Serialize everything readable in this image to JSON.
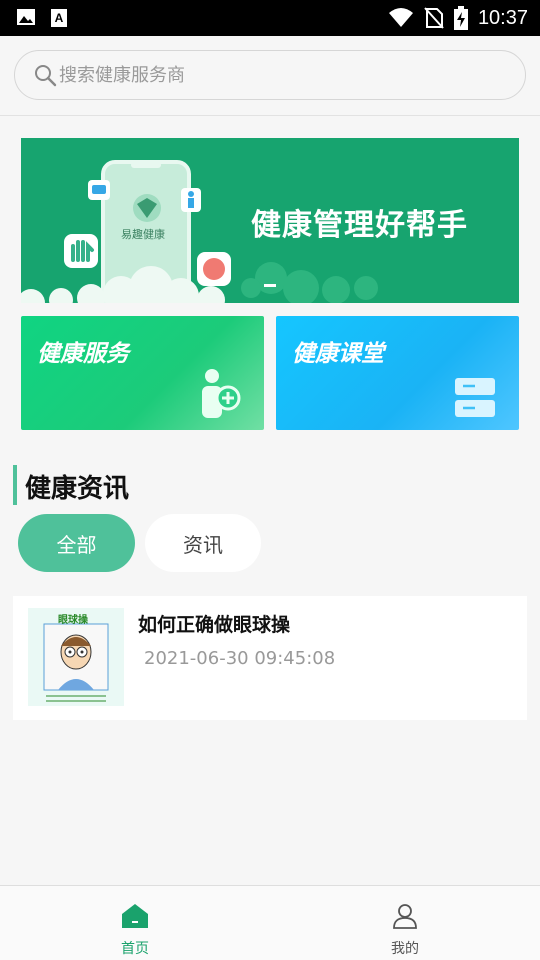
{
  "status_bar": {
    "time": "10:37",
    "icons": [
      "image-icon",
      "a-keyboard-icon",
      "wifi-icon",
      "no-sim-icon",
      "battery-charging-icon"
    ]
  },
  "search": {
    "placeholder": "搜索健康服务商"
  },
  "banner": {
    "headline": "健康管理好帮手",
    "app_name": "易趣健康",
    "background_color": "#17a46f"
  },
  "service_cards": [
    {
      "label": "健康服务",
      "icon": "person-add-icon",
      "color": "#10d482"
    },
    {
      "label": "健康课堂",
      "icon": "list-icon",
      "color": "#15c6ff"
    }
  ],
  "news_section": {
    "title": "健康资讯",
    "tabs": [
      {
        "label": "全部",
        "selected": true
      },
      {
        "label": "资讯",
        "selected": false
      }
    ],
    "items": [
      {
        "title": "如何正确做眼球操",
        "date": "2021-06-30 09:45:08",
        "thumbnail_caption": "眼球操"
      }
    ]
  },
  "bottom_nav": [
    {
      "label": "首页",
      "icon": "home-icon",
      "active": true
    },
    {
      "label": "我的",
      "icon": "user-icon",
      "active": false
    }
  ],
  "colors": {
    "accent": "#4fc19a",
    "nav_active": "#1aa26c"
  }
}
